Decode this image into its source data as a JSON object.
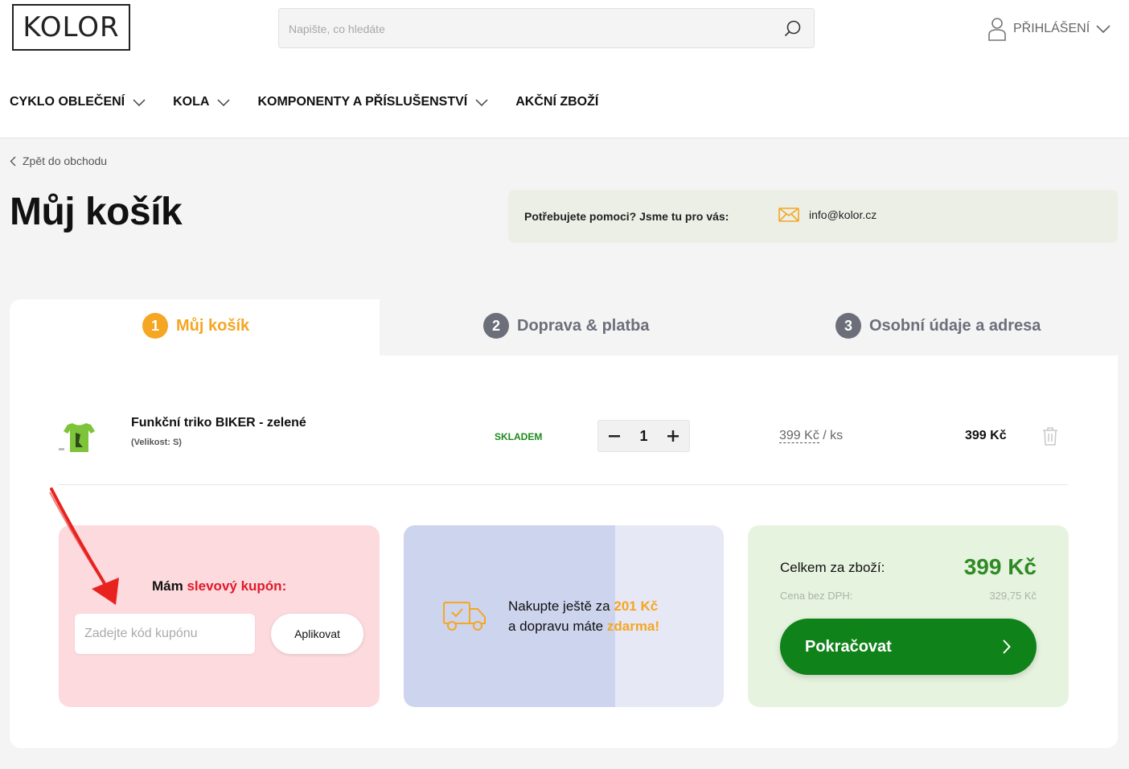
{
  "header": {
    "logo_text": "KOLOR",
    "search_placeholder": "Napište, co hledáte",
    "login_label": "PŘIHLÁŠENÍ"
  },
  "nav": {
    "items": [
      {
        "label": "CYKLO OBLEČENÍ",
        "has_dropdown": true
      },
      {
        "label": "KOLA",
        "has_dropdown": true
      },
      {
        "label": "KOMPONENTY A PŘÍSLUŠENSTVÍ",
        "has_dropdown": true
      },
      {
        "label": "AKČNÍ ZBOŽÍ",
        "has_dropdown": false
      }
    ]
  },
  "back_link": "Zpět do obchodu",
  "page_title": "Můj košík",
  "help": {
    "text": "Potřebujete pomoci? Jsme tu pro vás:",
    "email": "info@kolor.cz"
  },
  "steps": [
    {
      "num": "1",
      "label": "Můj košík",
      "active": true
    },
    {
      "num": "2",
      "label": "Doprava & platba",
      "active": false
    },
    {
      "num": "3",
      "label": "Osobní údaje a adresa",
      "active": false
    }
  ],
  "cart": {
    "items": [
      {
        "name": "Funkční triko BIKER - zelené",
        "variant": "(Velikost: S)",
        "stock": "SKLADEM",
        "quantity": "1",
        "unit_price": "399 Kč",
        "unit_suffix": "/ ks",
        "total": "399 Kč"
      }
    ]
  },
  "coupon": {
    "title_prefix": "Mám ",
    "title_highlight": "slevový kupón:",
    "placeholder": "Zadejte kód kupónu",
    "button": "Aplikovat"
  },
  "shipping": {
    "line1_prefix": "Nakupte ještě za ",
    "line1_amount": "201 Kč",
    "line2_prefix": "a dopravu máte ",
    "line2_highlight": "zdarma!",
    "progress_fraction": 0.66
  },
  "summary": {
    "label": "Celkem za zboží:",
    "total": "399 Kč",
    "vat_label": "Cena bez DPH:",
    "vat_value": "329,75 Kč",
    "continue_label": "Pokračovat"
  },
  "colors": {
    "accent_orange": "#f5a623",
    "green_primary": "#10821a",
    "coupon_red": "#e01a2b",
    "step_inactive": "#6c6e7a"
  }
}
